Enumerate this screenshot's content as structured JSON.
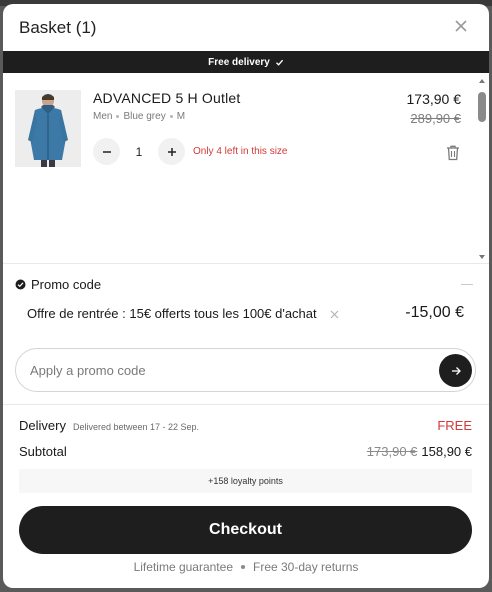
{
  "header": {
    "title": "Basket (1)"
  },
  "banner": {
    "text": "Free delivery"
  },
  "cart": {
    "items": [
      {
        "name": "ADVANCED 5 H Outlet",
        "gender": "Men",
        "color": "Blue grey",
        "size": "M",
        "quantity": "1",
        "stock_message": "Only 4 left in this size",
        "price_current": "173,90 €",
        "price_old": "289,90 €"
      }
    ]
  },
  "promo": {
    "title": "Promo code",
    "applied_label": "Offre de rentrée : 15€ offerts tous les 100€ d'achat",
    "applied_amount": "-15,00 €",
    "input_placeholder": "Apply a promo code"
  },
  "summary": {
    "delivery_label": "Delivery",
    "delivery_eta": "Delivered between 17 - 22 Sep.",
    "delivery_price": "FREE",
    "subtotal_label": "Subtotal",
    "subtotal_old": "173,90 €",
    "subtotal_new": "158,90 €",
    "loyalty": "+158 loyalty points"
  },
  "checkout": {
    "label": "Checkout"
  },
  "footer": {
    "guarantee": "Lifetime guarantee",
    "returns": "Free 30-day returns"
  },
  "colors": {
    "primary_dark": "#1e1e1e",
    "alert_red": "#d23a3a",
    "muted_text": "#7a7a7a"
  }
}
